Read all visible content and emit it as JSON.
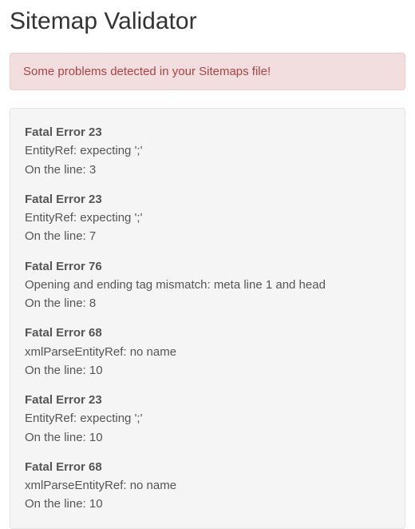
{
  "header": {
    "title": "Sitemap Validator"
  },
  "alert": {
    "message": "Some problems detected in your Sitemaps file!"
  },
  "errors": [
    {
      "title": "Fatal Error 23",
      "message": "EntityRef: expecting ';'",
      "line_text": "On the line: 3"
    },
    {
      "title": "Fatal Error 23",
      "message": "EntityRef: expecting ';'",
      "line_text": "On the line: 7"
    },
    {
      "title": "Fatal Error 76",
      "message": "Opening and ending tag mismatch: meta line 1 and head",
      "line_text": "On the line: 8"
    },
    {
      "title": "Fatal Error 68",
      "message": "xmlParseEntityRef: no name",
      "line_text": "On the line: 10"
    },
    {
      "title": "Fatal Error 23",
      "message": "EntityRef: expecting ';'",
      "line_text": "On the line: 10"
    },
    {
      "title": "Fatal Error 68",
      "message": "xmlParseEntityRef: no name",
      "line_text": "On the line: 10"
    }
  ]
}
